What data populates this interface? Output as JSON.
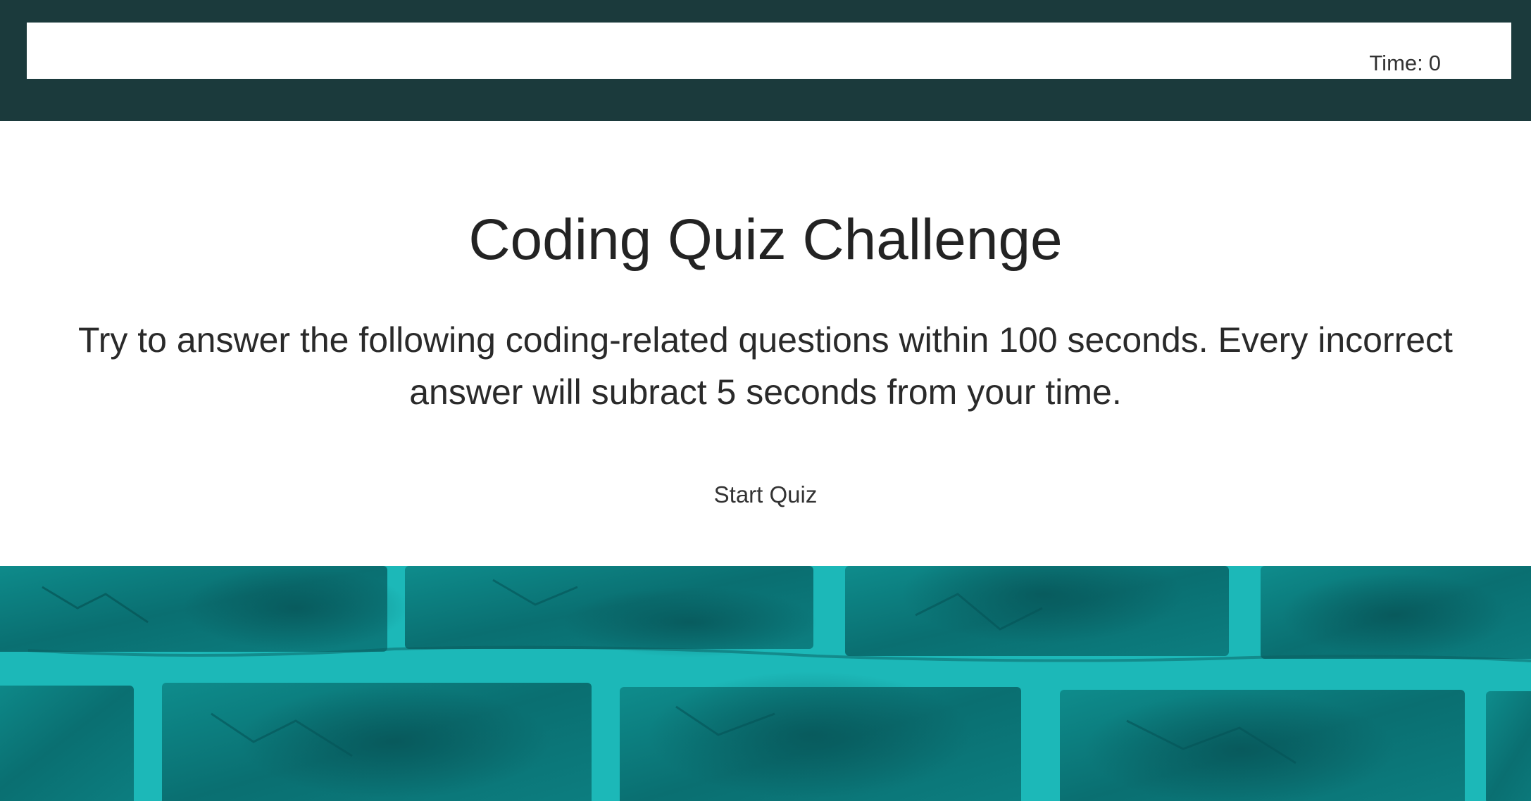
{
  "header": {
    "timer_label": "Time:",
    "timer_value": "0"
  },
  "main": {
    "title": "Coding Quiz Challenge",
    "description": "Try to answer the following coding-related questions within 100 seconds. Every incorrect answer will subract 5 seconds from your time.",
    "start_button_label": "Start Quiz"
  },
  "colors": {
    "header_bg": "#1b3a3c",
    "page_bg": "#ffffff",
    "brick": "#0d7f80",
    "mortar": "#1fc1c1"
  },
  "background_image": {
    "icon": "teal-brick-wall-texture"
  }
}
